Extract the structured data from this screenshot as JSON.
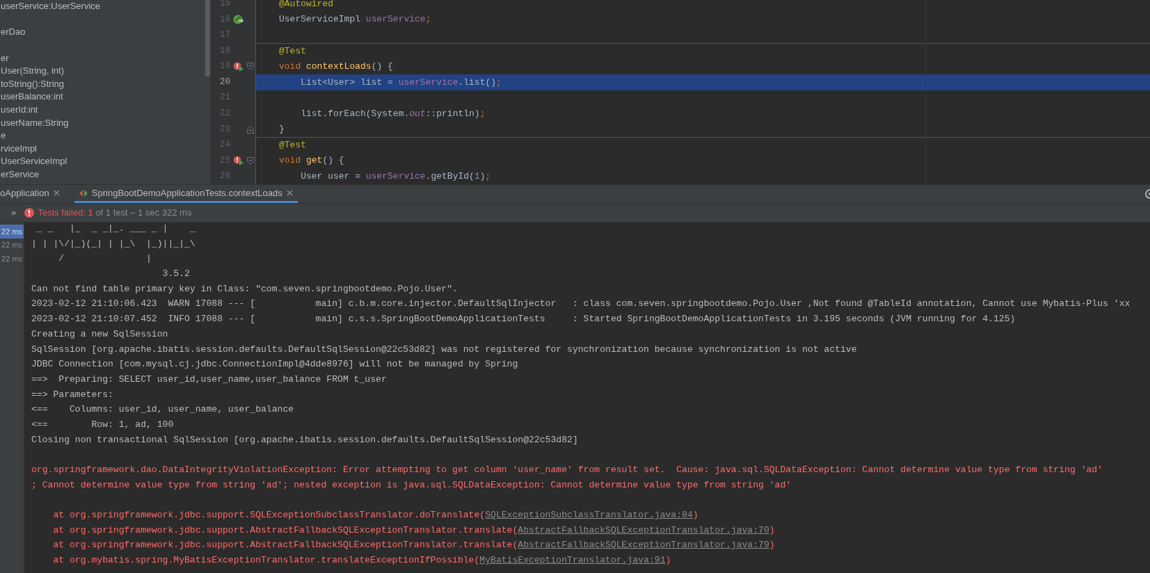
{
  "project_tree": {
    "items": [
      {
        "label": "userService:UserService"
      },
      {
        "label": "erDao"
      },
      {
        "label": "er"
      },
      {
        "label": "User(String, int)"
      },
      {
        "label": "toString():String"
      },
      {
        "label": "userBalance:int"
      },
      {
        "label": "userId:int"
      },
      {
        "label": "userName:String"
      },
      {
        "label": "e"
      },
      {
        "label": "rviceImpl"
      },
      {
        "label": "UserServiceImpl"
      },
      {
        "label": "erService"
      }
    ]
  },
  "editor": {
    "lines": [
      {
        "number": "15",
        "tokens": [
          {
            "kind": "annotation",
            "text": "@Autowired"
          }
        ]
      },
      {
        "number": "16",
        "markers": [
          {
            "kind": "bean"
          }
        ],
        "tokens": [
          {
            "kind": "plain",
            "text": "UserServiceImpl "
          },
          {
            "kind": "field",
            "text": "userService"
          },
          {
            "kind": "punct",
            "text": ";"
          }
        ]
      },
      {
        "number": "17"
      },
      {
        "number": "18",
        "separator_above": true,
        "tokens": [
          {
            "kind": "annotation",
            "text": "@Test"
          }
        ]
      },
      {
        "number": "19",
        "markers": [
          {
            "kind": "run_error"
          },
          {
            "kind": "fold_start"
          }
        ],
        "tokens": [
          {
            "kind": "keyword",
            "text": "void "
          },
          {
            "kind": "method",
            "text": "contextLoads"
          },
          {
            "kind": "plain",
            "text": "() {"
          }
        ]
      },
      {
        "number": "20",
        "current": true,
        "tokens": [
          {
            "kind": "plain",
            "text": "    List<User> list = "
          },
          {
            "kind": "field",
            "text": "userService"
          },
          {
            "kind": "plain",
            "text": ".list()"
          },
          {
            "kind": "punct",
            "text": ";"
          }
        ]
      },
      {
        "number": "21"
      },
      {
        "number": "22",
        "tokens": [
          {
            "kind": "plain",
            "text": "    list.forEach(System."
          },
          {
            "kind": "static",
            "text": "out"
          },
          {
            "kind": "plain",
            "text": "::println)"
          },
          {
            "kind": "punct",
            "text": ";"
          }
        ]
      },
      {
        "number": "23",
        "markers": [
          {
            "kind": "fold_end"
          }
        ],
        "tokens": [
          {
            "kind": "plain",
            "text": "}"
          }
        ]
      },
      {
        "number": "24",
        "separator_above": true,
        "tokens": [
          {
            "kind": "annotation",
            "text": "@Test"
          }
        ]
      },
      {
        "number": "25",
        "markers": [
          {
            "kind": "run_error"
          },
          {
            "kind": "fold_start"
          }
        ],
        "tokens": [
          {
            "kind": "keyword",
            "text": "void "
          },
          {
            "kind": "method",
            "text": "get"
          },
          {
            "kind": "plain",
            "text": "() {"
          }
        ]
      },
      {
        "number": "26",
        "tokens": [
          {
            "kind": "plain",
            "text": "    User user = "
          },
          {
            "kind": "field",
            "text": "userService"
          },
          {
            "kind": "plain",
            "text": ".getById("
          },
          {
            "kind": "number",
            "text": "1"
          },
          {
            "kind": "plain",
            "text": ")"
          },
          {
            "kind": "punct",
            "text": ";"
          }
        ]
      }
    ]
  },
  "run_window": {
    "tabs": [
      {
        "label": "oApplication",
        "selected": false
      },
      {
        "label": "SpringBootDemoApplicationTests.contextLoads",
        "selected": true,
        "kind": "test"
      }
    ],
    "status": {
      "expand": "»",
      "failed": "Tests failed: 1",
      "summary": "of 1 test – 1 sec 322 ms"
    },
    "test_tree": [
      {
        "duration": "22 ms",
        "selected": true
      },
      {
        "duration": "22 ms",
        "selected": false
      },
      {
        "duration": "22 ms",
        "selected": false
      }
    ],
    "console": [
      {
        "kind": "text",
        "text": " _ _   |_  _ _|_. ___ _ |    _"
      },
      {
        "kind": "text",
        "text": "| | |\\/|_)(_| | |_\\  |_)||_|_\\"
      },
      {
        "kind": "text",
        "text": "     /               |"
      },
      {
        "kind": "text",
        "text": "                        3.5.2"
      },
      {
        "kind": "text",
        "text": "Can not find table primary key in Class: \"com.seven.springbootdemo.Pojo.User\"."
      },
      {
        "kind": "text",
        "text": "2023-02-12 21:10:06.423  WARN 17088 --- [           main] c.b.m.core.injector.DefaultSqlInjector   : class com.seven.springbootdemo.Pojo.User ,Not found @TableId annotation, Cannot use Mybatis-Plus 'xx"
      },
      {
        "kind": "text",
        "text": "2023-02-12 21:10:07.452  INFO 17088 --- [           main] c.s.s.SpringBootDemoApplicationTests     : Started SpringBootDemoApplicationTests in 3.195 seconds (JVM running for 4.125)"
      },
      {
        "kind": "text",
        "text": "Creating a new SqlSession"
      },
      {
        "kind": "text",
        "text": "SqlSession [org.apache.ibatis.session.defaults.DefaultSqlSession@22c53d82] was not registered for synchronization because synchronization is not active"
      },
      {
        "kind": "text",
        "text": "JDBC Connection [com.mysql.cj.jdbc.ConnectionImpl@4dde8976] will not be managed by Spring"
      },
      {
        "kind": "text",
        "text": "==>  Preparing: SELECT user_id,user_name,user_balance FROM t_user"
      },
      {
        "kind": "text",
        "text": "==> Parameters: "
      },
      {
        "kind": "text",
        "text": "<==    Columns: user_id, user_name, user_balance"
      },
      {
        "kind": "text",
        "text": "<==        Row: 1, ad, 100"
      },
      {
        "kind": "text",
        "text": "Closing non transactional SqlSession [org.apache.ibatis.session.defaults.DefaultSqlSession@22c53d82]"
      },
      {
        "kind": "blank"
      },
      {
        "kind": "error",
        "text": "org.springframework.dao.DataIntegrityViolationException: Error attempting to get column 'user_name' from result set.  Cause: java.sql.SQLDataException: Cannot determine value type from string 'ad'"
      },
      {
        "kind": "error",
        "text": "; Cannot determine value type from string 'ad'; nested exception is java.sql.SQLDataException: Cannot determine value type from string 'ad'"
      },
      {
        "kind": "blank"
      },
      {
        "kind": "trace",
        "text": "    at org.springframework.jdbc.support.SQLExceptionSubclassTranslator.doTranslate(",
        "link": "SQLExceptionSubclassTranslator.java:84",
        "tail": ")"
      },
      {
        "kind": "trace",
        "text": "    at org.springframework.jdbc.support.AbstractFallbackSQLExceptionTranslator.translate(",
        "link": "AbstractFallbackSQLExceptionTranslator.java:70",
        "tail": ")"
      },
      {
        "kind": "trace",
        "text": "    at org.springframework.jdbc.support.AbstractFallbackSQLExceptionTranslator.translate(",
        "link": "AbstractFallbackSQLExceptionTranslator.java:79",
        "tail": ")"
      },
      {
        "kind": "trace",
        "text": "    at org.mybatis.spring.MyBatisExceptionTranslator.translateExceptionIfPossible(",
        "link": "MyBatisExceptionTranslator.java:91",
        "tail": ")"
      }
    ]
  }
}
